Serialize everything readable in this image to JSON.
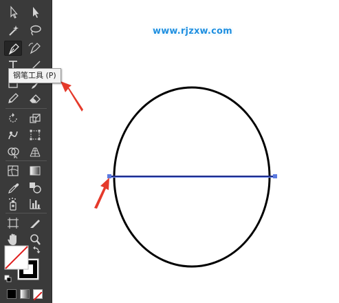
{
  "watermark": {
    "text": "www.rjzxw.com"
  },
  "tooltip": {
    "label": "钢笔工具 (P)"
  },
  "tools": [
    {
      "name": "selection-tool",
      "icon": "selection-arrow-icon"
    },
    {
      "name": "direct-selection-tool",
      "icon": "direct-selection-arrow-icon"
    },
    {
      "name": "magic-wand-tool",
      "icon": "magic-wand-icon"
    },
    {
      "name": "lasso-tool",
      "icon": "lasso-icon"
    },
    {
      "name": "pen-tool",
      "icon": "pen-icon",
      "active": true
    },
    {
      "name": "curvature-tool",
      "icon": "curvature-pen-icon"
    },
    {
      "name": "type-tool",
      "icon": "type-icon"
    },
    {
      "name": "line-segment-tool",
      "icon": "line-segment-icon"
    },
    {
      "name": "rectangle-tool",
      "icon": "rectangle-icon"
    },
    {
      "name": "paintbrush-tool",
      "icon": "paintbrush-icon"
    },
    {
      "name": "pencil-tool",
      "icon": "pencil-icon"
    },
    {
      "name": "eraser-tool",
      "icon": "eraser-icon"
    },
    {
      "name": "rotate-tool",
      "icon": "rotate-icon"
    },
    {
      "name": "scale-tool",
      "icon": "scale-icon"
    },
    {
      "name": "warp-tool",
      "icon": "warp-icon"
    },
    {
      "name": "free-transform-tool",
      "icon": "free-transform-icon"
    },
    {
      "name": "shape-builder-tool",
      "icon": "shape-builder-icon"
    },
    {
      "name": "perspective-grid-tool",
      "icon": "perspective-grid-icon"
    },
    {
      "name": "mesh-tool",
      "icon": "mesh-icon"
    },
    {
      "name": "gradient-tool",
      "icon": "gradient-icon"
    },
    {
      "name": "eyedropper-tool",
      "icon": "eyedropper-icon"
    },
    {
      "name": "blend-tool",
      "icon": "blend-icon"
    },
    {
      "name": "symbol-sprayer-tool",
      "icon": "symbol-sprayer-icon"
    },
    {
      "name": "column-graph-tool",
      "icon": "column-graph-icon"
    },
    {
      "name": "artboard-tool",
      "icon": "artboard-icon"
    },
    {
      "name": "slice-tool",
      "icon": "slice-icon"
    },
    {
      "name": "hand-tool",
      "icon": "hand-icon"
    },
    {
      "name": "zoom-tool",
      "icon": "zoom-icon"
    }
  ],
  "colors": {
    "toolbar_bg": "#3a3a3a",
    "icon": "#d4d4d4",
    "ellipse_stroke": "#000000",
    "path_line": "#1f2d8a",
    "anchor": "#5b7ae0",
    "annotation_arrow": "#e53a2b",
    "watermark": "#1e8fe0",
    "fill_swatch": "#ffffff",
    "none_slash": "#e02020",
    "stroke_swatch": "#000000"
  }
}
